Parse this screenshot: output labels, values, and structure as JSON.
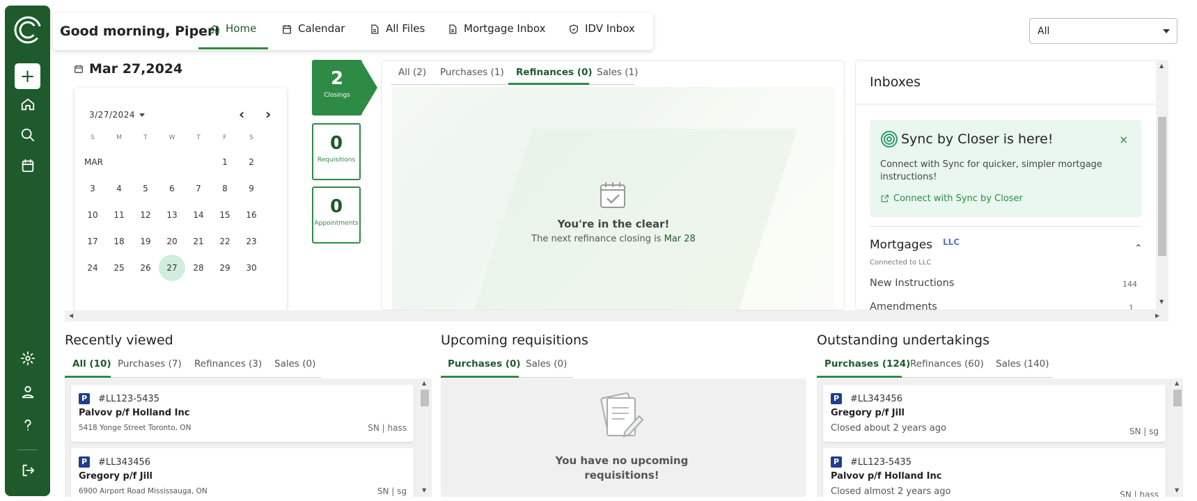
{
  "greeting": "Good morning, Piper!",
  "nav": {
    "home": "Home",
    "calendar": "Calendar",
    "all_files": "All Files",
    "mortgage_inbox": "Mortgage Inbox",
    "idv_inbox": "IDV Inbox"
  },
  "filter": {
    "selected": "All"
  },
  "date_header": "Mar 27,2024",
  "calendar": {
    "selector": "3/27/2024",
    "prev": "‹",
    "next": "›",
    "dow": [
      "S",
      "M",
      "T",
      "W",
      "T",
      "F",
      "S"
    ],
    "month_label": "MAR",
    "week1": [
      "1",
      "2"
    ],
    "week2": [
      "3",
      "4",
      "5",
      "6",
      "7",
      "8",
      "9"
    ],
    "week3": [
      "10",
      "11",
      "12",
      "13",
      "14",
      "15",
      "16"
    ],
    "week4": [
      "17",
      "18",
      "19",
      "20",
      "21",
      "22",
      "23"
    ],
    "week5": [
      "24",
      "25",
      "26",
      "27",
      "28",
      "29",
      "30"
    ],
    "selected_day": "27"
  },
  "stats": {
    "closings": {
      "value": "2",
      "label": "Closings"
    },
    "requisitions": {
      "value": "0",
      "label": "Requisitions"
    },
    "appointments": {
      "value": "0",
      "label": "Appointments"
    }
  },
  "closings_panel": {
    "tabs": [
      "All (2)",
      "Purchases (1)",
      "Refinances (0)",
      "Sales (1)"
    ],
    "active_tab": "Refinances (0)",
    "empty_title": "You're in the clear!",
    "empty_sub": "The next refinance closing is",
    "empty_date": "Mar 28"
  },
  "inboxes": {
    "title": "Inboxes",
    "sync_title": "Sync by Closer is here!",
    "sync_close": "×",
    "sync_desc": "Connect with Sync for quicker, simpler mortgage instructions!",
    "sync_link": "Connect with Sync by Closer",
    "mortgages": "Mortgages",
    "mortgages_logo": "LLC",
    "connected": "Connected to LLC",
    "items": [
      {
        "label": "New Instructions",
        "count": "144"
      },
      {
        "label": "Amendments",
        "count": "1"
      }
    ]
  },
  "recently_viewed": {
    "title": "Recently viewed",
    "tabs": [
      "All (10)",
      "Purchases (7)",
      "Refinances (3)",
      "Sales (0)"
    ],
    "cards": [
      {
        "badge": "P",
        "id": "#LL123-5435",
        "name": "Palvov p/f Holland Inc",
        "addr": "5418 Yonge Street   Toronto, ON",
        "meta": "SN | hass"
      },
      {
        "badge": "P",
        "id": "#LL343456",
        "name": "Gregory p/f Jill",
        "addr": "6900 Airport Road   Mississauga, ON",
        "meta": "SN | sg"
      }
    ]
  },
  "upcoming": {
    "title": "Upcoming requisitions",
    "tabs": [
      "Purchases (0)",
      "Sales (0)"
    ],
    "empty": "You have no upcoming requisitions!"
  },
  "undertakings": {
    "title": "Outstanding undertakings",
    "tabs": [
      "Purchases (124)",
      "Refinances (60)",
      "Sales (140)"
    ],
    "cards": [
      {
        "badge": "P",
        "id": "#LL343456",
        "name": "Gregory p/f Jill",
        "status": "Closed about 2 years ago",
        "meta": "SN | sg"
      },
      {
        "badge": "P",
        "id": "#LL123-5435",
        "name": "Palvov p/f Holland Inc",
        "status": "Closed almost 2 years ago",
        "meta": "SN | hass"
      }
    ]
  },
  "colors": {
    "brand": "#1e5a2b",
    "accent": "#2e8b45",
    "badge": "#1e3f8a"
  }
}
